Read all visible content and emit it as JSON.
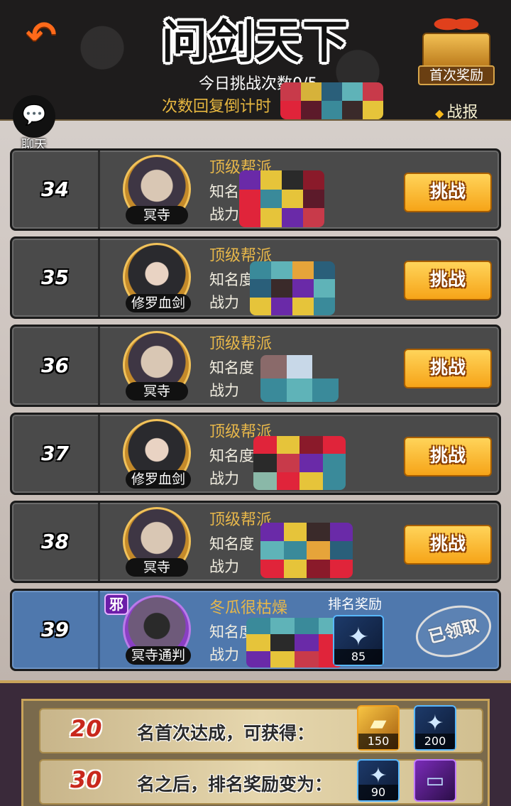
{
  "header": {
    "back_icon": "back-arrow-icon",
    "title": "问剑天下",
    "challenges_today": "今日挑战次数0/5",
    "recover_countdown": "次数回复倒计时",
    "first_reward_label": "首次奖励",
    "battle_report_label": "战报",
    "chat_label": "聊天"
  },
  "row_labels": {
    "fame_prefix": "知名度",
    "power_prefix": "战力",
    "challenge_button": "挑战",
    "rank_reward_title": "排名奖励",
    "claimed_stamp": "已领取"
  },
  "rows": [
    {
      "rank": "34",
      "guild": "顶级帮派",
      "hero": "冥寺"
    },
    {
      "rank": "35",
      "guild": "顶级帮派",
      "hero": "修罗血剑"
    },
    {
      "rank": "36",
      "guild": "顶级帮派",
      "hero": "冥寺"
    },
    {
      "rank": "37",
      "guild": "顶级帮派",
      "hero": "修罗血剑"
    },
    {
      "rank": "38",
      "guild": "顶级帮派",
      "hero": "冥寺"
    }
  ],
  "my_row": {
    "rank": "39",
    "player_name": "冬瓜很枯燥",
    "hero": "冥寺通判",
    "badge": "邪",
    "reward_count": "85"
  },
  "bonus": [
    {
      "rank": "20",
      "text": "名首次达成，可获得：",
      "items": [
        {
          "icon": "gold-bar-icon",
          "count": "150"
        },
        {
          "icon": "shards-icon",
          "count": "200"
        }
      ]
    },
    {
      "rank": "30",
      "text": "名之后，排名奖励变为：",
      "items": [
        {
          "icon": "shards-icon",
          "count": "90"
        },
        {
          "icon": "scroll-item-icon",
          "count": ""
        }
      ]
    }
  ],
  "colors": {
    "accent_gold": "#e7b74a",
    "button_orange": "#f6a418",
    "my_row_blue": "#4f78ad"
  }
}
